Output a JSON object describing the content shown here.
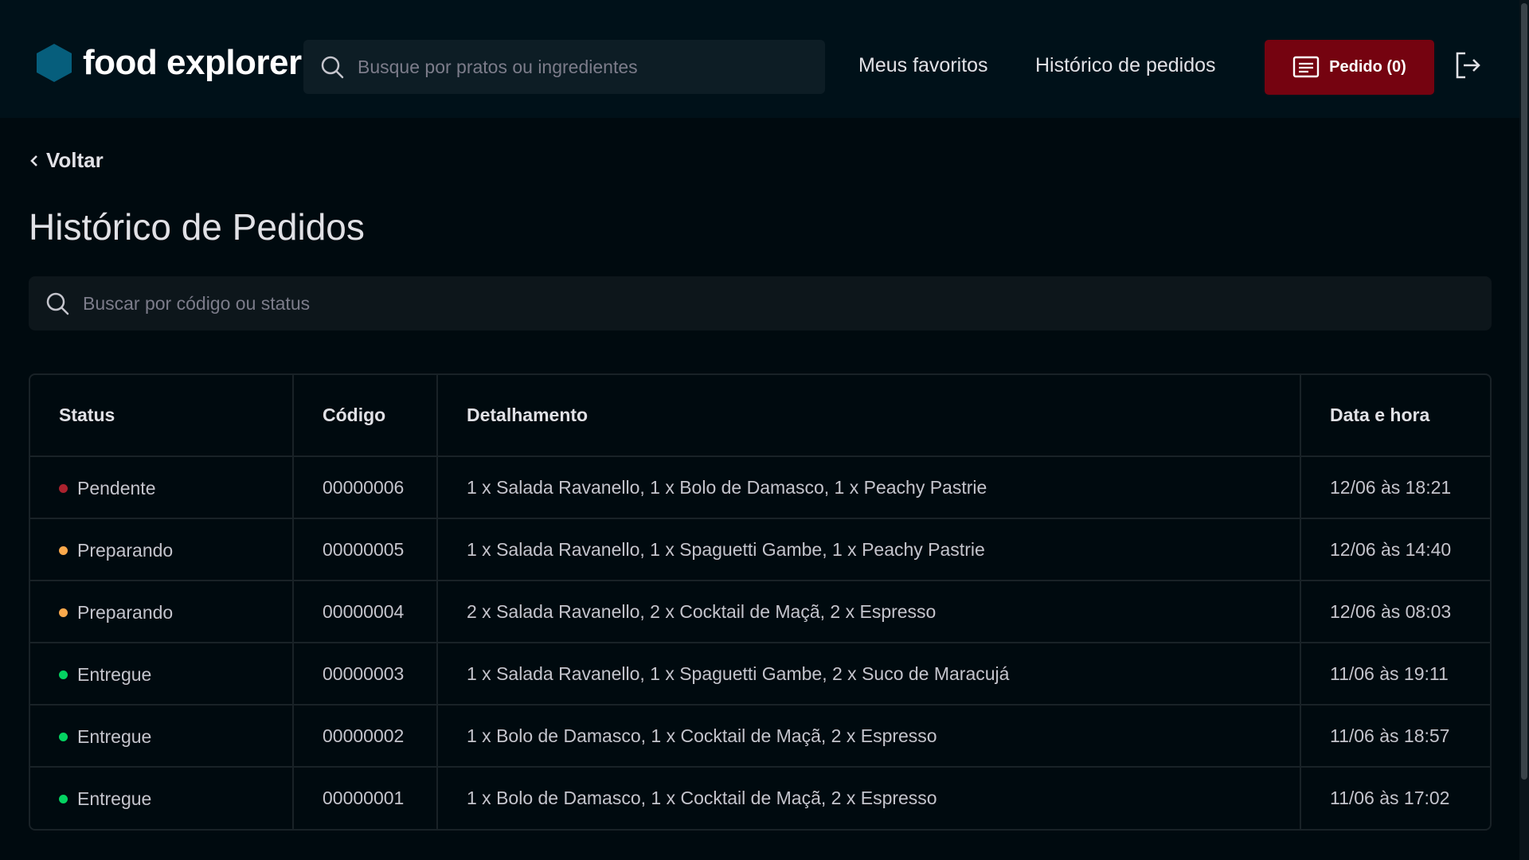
{
  "header": {
    "brand_name": "food explorer",
    "search_placeholder": "Busque por pratos ou ingredientes",
    "nav": {
      "favorites": "Meus favoritos",
      "history": "Histórico de pedidos"
    },
    "order_button": "Pedido (0)",
    "icons": {
      "brand": "hexagon-logo-icon",
      "search": "search-icon",
      "receipt": "receipt-icon",
      "logout": "sign-out-icon"
    },
    "accent_color": "#065E7C",
    "button_color": "#750310"
  },
  "back": {
    "label": "Voltar"
  },
  "page_title": "Histórico de Pedidos",
  "search": {
    "placeholder": "Buscar por código ou status"
  },
  "table": {
    "columns": [
      "Status",
      "Código",
      "Detalhamento",
      "Data e hora"
    ],
    "rows": [
      {
        "status": "Pendente",
        "status_color": "#AB222E",
        "code": "00000006",
        "detail": "1 x Salada Ravanello, 1 x Bolo de Damasco, 1 x Peachy Pastrie",
        "datetime": "12/06 às 18:21"
      },
      {
        "status": "Preparando",
        "status_color": "#FBA94C",
        "code": "00000005",
        "detail": "1 x Salada Ravanello, 1 x Spaguetti Gambe, 1 x Peachy Pastrie",
        "datetime": "12/06 às 14:40"
      },
      {
        "status": "Preparando",
        "status_color": "#FBA94C",
        "code": "00000004",
        "detail": "2 x Salada Ravanello, 2 x Cocktail de Maçã, 2 x Espresso",
        "datetime": "12/06 às 08:03"
      },
      {
        "status": "Entregue",
        "status_color": "#04D361",
        "code": "00000003",
        "detail": "1 x Salada Ravanello, 1 x Spaguetti Gambe, 2 x Suco de Maracujá",
        "datetime": "11/06 às 19:11"
      },
      {
        "status": "Entregue",
        "status_color": "#04D361",
        "code": "00000002",
        "detail": "1 x Bolo de Damasco, 1 x Cocktail de Maçã, 2 x Espresso",
        "datetime": "11/06 às 18:57"
      },
      {
        "status": "Entregue",
        "status_color": "#04D361",
        "code": "00000001",
        "detail": "1 x Bolo de Damasco, 1 x Cocktail de Maçã, 2 x Espresso",
        "datetime": "11/06 às 17:02"
      }
    ]
  }
}
